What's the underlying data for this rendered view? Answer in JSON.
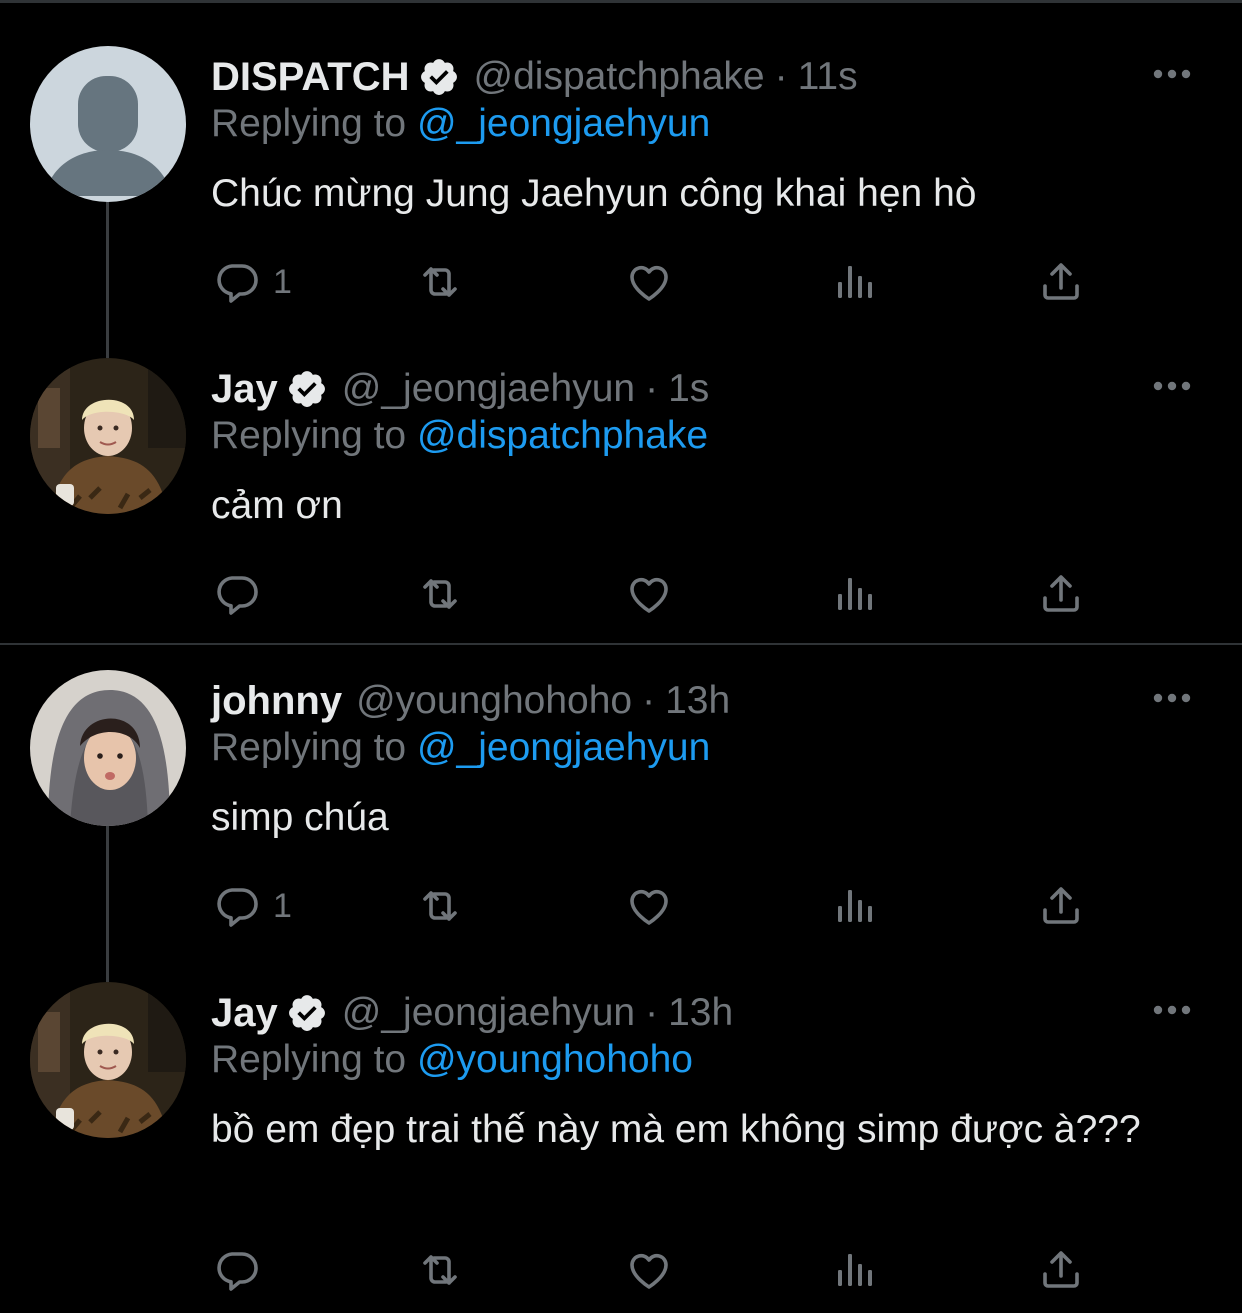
{
  "colors": {
    "background": "#000000",
    "text": "#e7e9ea",
    "muted": "#71767b",
    "link": "#1d9bf0",
    "divider": "#2f3336"
  },
  "tweets": [
    {
      "name": "DISPATCH",
      "verified": true,
      "handle": "@dispatchphake",
      "separator": "·",
      "time": "11s",
      "replying_prefix": "Replying to",
      "replying_to": "@_jeongjaehyun",
      "text": "Chúc mừng Jung Jaehyun công khai hẹn hò",
      "reply_count": "1",
      "avatar": "default-avatar-icon"
    },
    {
      "name": "Jay",
      "verified": true,
      "handle": "@_jeongjaehyun",
      "separator": "·",
      "time": "1s",
      "replying_prefix": "Replying to",
      "replying_to": "@dispatchphake",
      "text": "cảm ơn",
      "reply_count": "",
      "avatar": "profile-photo-blond"
    },
    {
      "name": "johnny",
      "verified": false,
      "handle": "@younghohoho",
      "separator": "·",
      "time": "13h",
      "replying_prefix": "Replying to",
      "replying_to": "@_jeongjaehyun",
      "text": "simp chúa",
      "reply_count": "1",
      "avatar": "profile-photo-hood"
    },
    {
      "name": "Jay",
      "verified": true,
      "handle": "@_jeongjaehyun",
      "separator": "·",
      "time": "13h",
      "replying_prefix": "Replying to",
      "replying_to": "@younghohoho",
      "text": "bồ em đẹp trai thế này mà em không simp được à???",
      "reply_count": "",
      "avatar": "profile-photo-blond"
    }
  ],
  "icons": [
    "reply-icon",
    "retweet-icon",
    "like-icon",
    "views-icon",
    "share-icon",
    "more-icon",
    "verified-badge-icon"
  ]
}
